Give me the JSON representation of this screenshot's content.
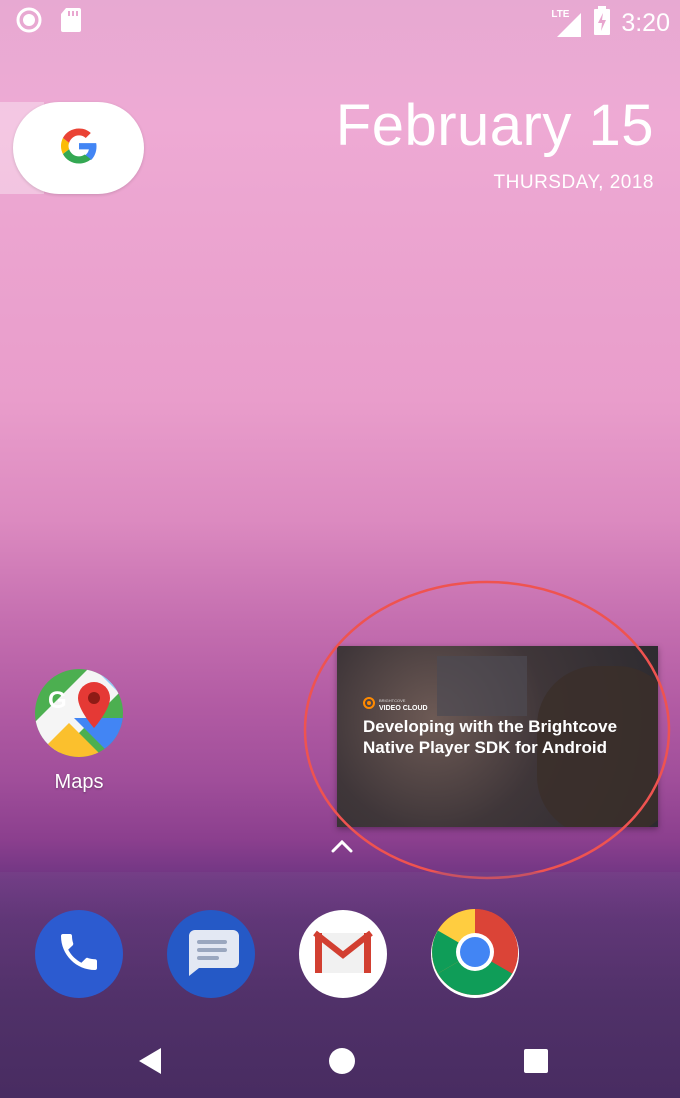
{
  "status_bar": {
    "time": "3:20",
    "network_label": "LTE",
    "left_icons": [
      "circle-icon",
      "sd-card-icon"
    ],
    "right_icons": [
      "lte-signal-icon",
      "battery-charging-icon"
    ]
  },
  "search_widget": {
    "icon": "google-g-icon"
  },
  "date_widget": {
    "date": "February 15",
    "day_year": "THURSDAY, 2018"
  },
  "apps": [
    {
      "label": "Maps",
      "icon": "maps-icon"
    }
  ],
  "video_overlay": {
    "brand_small": "BRIGHTCOVE",
    "brand": "VIDEO CLOUD",
    "title": "Developing with the Brightcove Native Player SDK for Android",
    "annotation_color": "#ef5350"
  },
  "app_drawer_handle": {
    "icon": "chevron-up-icon"
  },
  "dock": [
    {
      "name": "Phone",
      "icon": "phone-icon",
      "color": "#2c5bd0"
    },
    {
      "name": "Messages",
      "icon": "messages-icon",
      "color": "#2559c6"
    },
    {
      "name": "Gmail",
      "icon": "gmail-icon",
      "color": "#ffffff"
    },
    {
      "name": "Chrome",
      "icon": "chrome-icon",
      "color": "#ffffff"
    }
  ],
  "nav_bar": {
    "back": "back-icon",
    "home": "home-icon",
    "recents": "recents-icon"
  }
}
